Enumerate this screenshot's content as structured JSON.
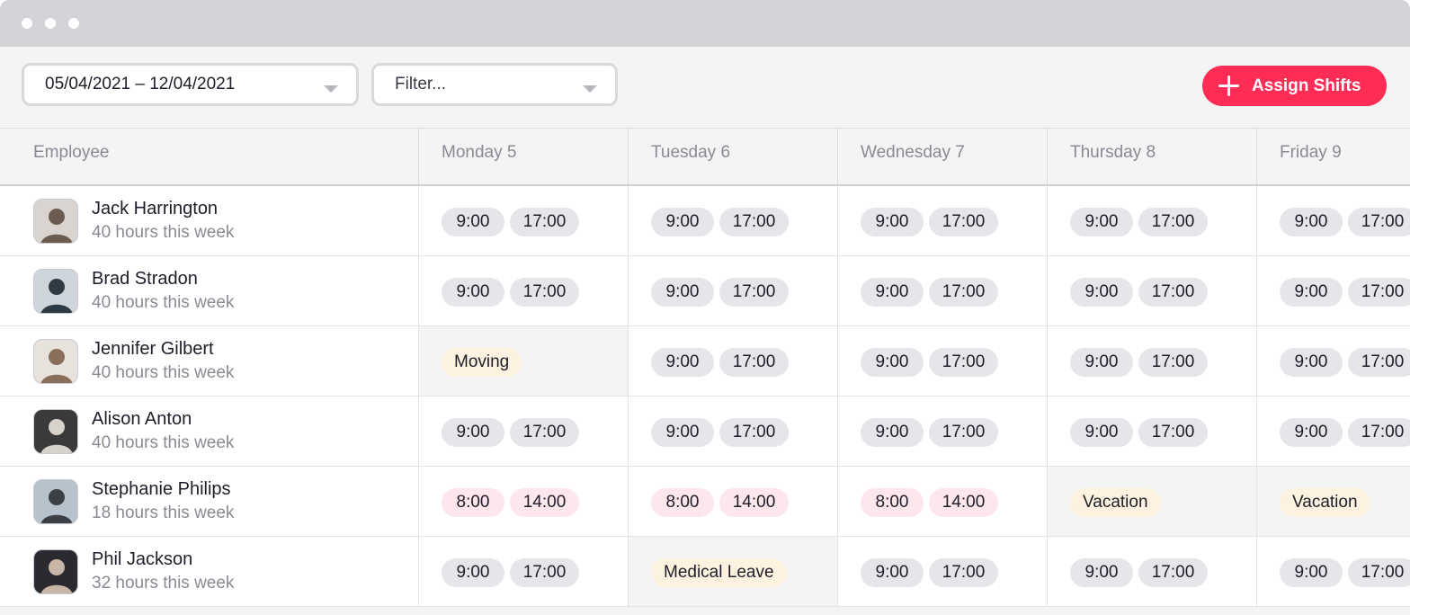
{
  "toolbar": {
    "date_range": "05/04/2021 – 12/04/2021",
    "filter_placeholder": "Filter...",
    "assign_label": "Assign Shifts"
  },
  "colors": {
    "accent": "#ff2d55",
    "shift": "#e6e6ea",
    "part_shift": "#fde6ec",
    "leave": "#fdf1df"
  },
  "table": {
    "headers": [
      "Employee",
      "Monday 5",
      "Tuesday 6",
      "Wednesday 7",
      "Thursday 8",
      "Friday 9"
    ],
    "rows": [
      {
        "name": "Jack Harrington",
        "hours": "40 hours this week",
        "avatar": "avatar-jack",
        "days": [
          {
            "type": "shift",
            "start": "9:00",
            "end": "17:00"
          },
          {
            "type": "shift",
            "start": "9:00",
            "end": "17:00"
          },
          {
            "type": "shift",
            "start": "9:00",
            "end": "17:00"
          },
          {
            "type": "shift",
            "start": "9:00",
            "end": "17:00"
          },
          {
            "type": "shift",
            "start": "9:00",
            "end": "17:00"
          }
        ]
      },
      {
        "name": "Brad Stradon",
        "hours": "40 hours this week",
        "avatar": "avatar-brad",
        "days": [
          {
            "type": "shift",
            "start": "9:00",
            "end": "17:00"
          },
          {
            "type": "shift",
            "start": "9:00",
            "end": "17:00"
          },
          {
            "type": "shift",
            "start": "9:00",
            "end": "17:00"
          },
          {
            "type": "shift",
            "start": "9:00",
            "end": "17:00"
          },
          {
            "type": "shift",
            "start": "9:00",
            "end": "17:00"
          }
        ]
      },
      {
        "name": "Jennifer Gilbert",
        "hours": "40 hours this week",
        "avatar": "avatar-jennifer",
        "days": [
          {
            "type": "leave",
            "label": "Moving"
          },
          {
            "type": "shift",
            "start": "9:00",
            "end": "17:00"
          },
          {
            "type": "shift",
            "start": "9:00",
            "end": "17:00"
          },
          {
            "type": "shift",
            "start": "9:00",
            "end": "17:00"
          },
          {
            "type": "shift",
            "start": "9:00",
            "end": "17:00"
          }
        ]
      },
      {
        "name": "Alison Anton",
        "hours": "40 hours this week",
        "avatar": "avatar-alison",
        "days": [
          {
            "type": "shift",
            "start": "9:00",
            "end": "17:00"
          },
          {
            "type": "shift",
            "start": "9:00",
            "end": "17:00"
          },
          {
            "type": "shift",
            "start": "9:00",
            "end": "17:00"
          },
          {
            "type": "shift",
            "start": "9:00",
            "end": "17:00"
          },
          {
            "type": "shift",
            "start": "9:00",
            "end": "17:00"
          }
        ]
      },
      {
        "name": "Stephanie Philips",
        "hours": "18 hours this week",
        "avatar": "avatar-stephanie",
        "days": [
          {
            "type": "part",
            "start": "8:00",
            "end": "14:00"
          },
          {
            "type": "part",
            "start": "8:00",
            "end": "14:00"
          },
          {
            "type": "part",
            "start": "8:00",
            "end": "14:00"
          },
          {
            "type": "leave",
            "label": "Vacation"
          },
          {
            "type": "leave",
            "label": "Vacation"
          }
        ]
      },
      {
        "name": "Phil Jackson",
        "hours": "32 hours this week",
        "avatar": "avatar-phil",
        "days": [
          {
            "type": "shift",
            "start": "9:00",
            "end": "17:00"
          },
          {
            "type": "leave",
            "label": "Medical Leave"
          },
          {
            "type": "shift",
            "start": "9:00",
            "end": "17:00"
          },
          {
            "type": "shift",
            "start": "9:00",
            "end": "17:00"
          },
          {
            "type": "shift",
            "start": "9:00",
            "end": "17:00"
          }
        ]
      }
    ]
  }
}
